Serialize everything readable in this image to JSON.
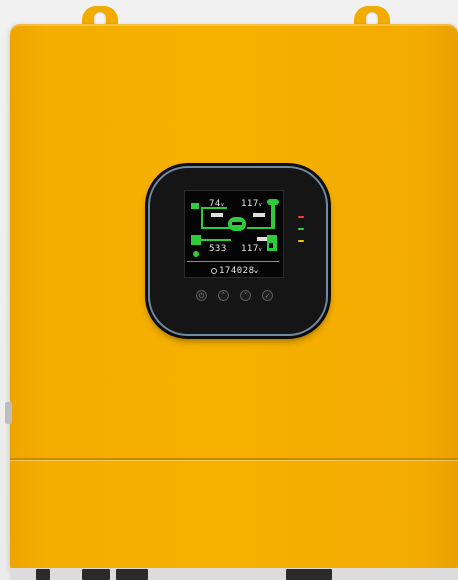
{
  "device": {
    "body_color": "#f5b000",
    "panel_color": "#151515",
    "panel_border_color": "#6f8aa3",
    "lcd_accent": "#2ecb3a"
  },
  "lcd": {
    "pv_value": "74",
    "pv_unit": "v",
    "grid_value": "117",
    "grid_unit": "v",
    "battery_value": "533",
    "load_value": "117",
    "load_unit": "v",
    "energy_value": "174028",
    "energy_unit": "w"
  },
  "indicators": [
    {
      "name": "ac-in-indicator",
      "color": "#ff3b30"
    },
    {
      "name": "inverter-indicator",
      "color": "#37c94a"
    },
    {
      "name": "fault-indicator",
      "color": "#f5c400"
    }
  ],
  "buttons": [
    {
      "name": "menu-button",
      "icon": "power-icon"
    },
    {
      "name": "up-button",
      "icon": "chevron-up-icon"
    },
    {
      "name": "down-button",
      "icon": "chevron-down-icon"
    },
    {
      "name": "enter-button",
      "icon": "check-icon"
    }
  ]
}
